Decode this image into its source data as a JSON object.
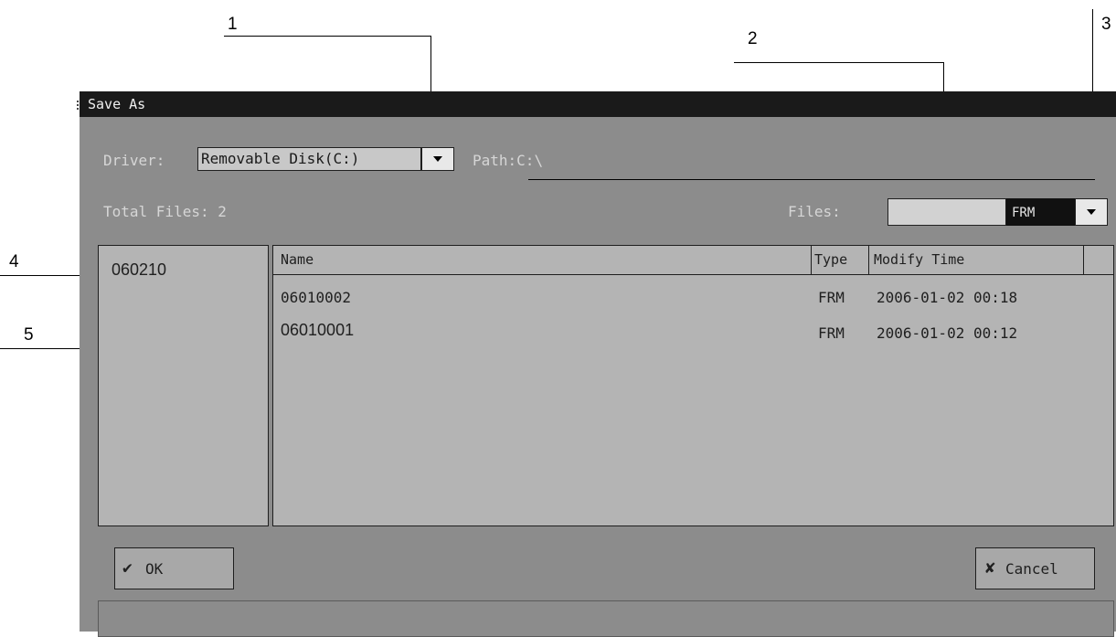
{
  "callouts": [
    "1",
    "2",
    "3",
    "4",
    "5"
  ],
  "window": {
    "title": "Save As"
  },
  "toolbar": {
    "driver_label": "Driver:",
    "driver_value": "Removable Disk(C:)",
    "path_label": "Path:",
    "path_value": "C:\\"
  },
  "summary": {
    "total_files_label": "Total Files: 2",
    "files_label": "Files:",
    "filename_value": "",
    "filetype_value": "FRM"
  },
  "folders": [
    {
      "name": "060210"
    }
  ],
  "file_list": {
    "columns": [
      "Name",
      "Type",
      "Modify Time"
    ],
    "rows": [
      {
        "name": "06010002",
        "type": "FRM",
        "modified": "2006-01-02 00:18"
      },
      {
        "name": "06010001",
        "type": "FRM",
        "modified": "2006-01-02 00:12"
      }
    ]
  },
  "buttons": {
    "ok_label": "OK",
    "cancel_label": "Cancel"
  },
  "icons": {
    "ok": "checkmark-icon",
    "cancel": "x-mark-icon",
    "dropdown": "triangle-down-icon"
  },
  "colors": {
    "titlebar": "#1a1a1a",
    "window": "#8c8c8c",
    "panel": "#b4b4b4",
    "filetype_box": "#111111"
  }
}
